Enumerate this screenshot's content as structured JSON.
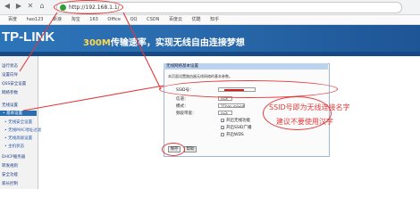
{
  "browser": {
    "url": "http://192.168.1.1/",
    "nav": [
      "◀",
      "▶",
      "✕",
      "⌂"
    ],
    "bookmarks": [
      "百度",
      "hao123",
      "新浪",
      "淘宝",
      "163",
      "Office",
      "QQ",
      "CSDN",
      "百度云",
      "优酷",
      "知乎"
    ]
  },
  "header": {
    "brand": "TP-LINK",
    "slogan_highlight": "300M",
    "slogan_rest": "传输速率，实现无线自由连接梦想"
  },
  "sidebar": {
    "items": [
      {
        "label": "运行状态",
        "level": 0
      },
      {
        "label": "设置向导",
        "level": 0
      },
      {
        "label": "QSS安全设置",
        "level": 0
      },
      {
        "label": "网络参数",
        "level": 0
      },
      {
        "label": "无线设置",
        "level": 0
      },
      {
        "label": "• 基本设置",
        "level": 1,
        "active": true
      },
      {
        "label": "• 无线安全设置",
        "level": 1
      },
      {
        "label": "• 无线MAC地址过滤",
        "level": 1
      },
      {
        "label": "• 无线高级设置",
        "level": 1
      },
      {
        "label": "• 主机状态",
        "level": 1
      },
      {
        "label": "DHCP服务器",
        "level": 0
      },
      {
        "label": "转发规则",
        "level": 0
      },
      {
        "label": "安全功能",
        "level": 0
      },
      {
        "label": "家长控制",
        "level": 0
      }
    ]
  },
  "panel": {
    "title": "无线网络基本设置",
    "intro": "本页面设置路由器无线网络的基本参数。",
    "ssid_label": "SSID号：",
    "ssid_value": "",
    "channel_label": "信道：",
    "channel_value": "自动",
    "mode_label": "模式：",
    "mode_value": "11bgn mixed",
    "bandwidth_label": "频段带宽：",
    "bandwidth_value": "自动",
    "checkbox_wireless_label": "开启无线功能",
    "checkbox_ssid_broadcast_label": "开启SSID广播",
    "checkbox_wds_label": "开启WDS",
    "save_label": "保存",
    "help_label": "帮助"
  },
  "annotation": {
    "note_line1": "SSID号即为无线连接名字",
    "note_line2": "建议不要使用汉字",
    "color": "#e03a3a"
  }
}
